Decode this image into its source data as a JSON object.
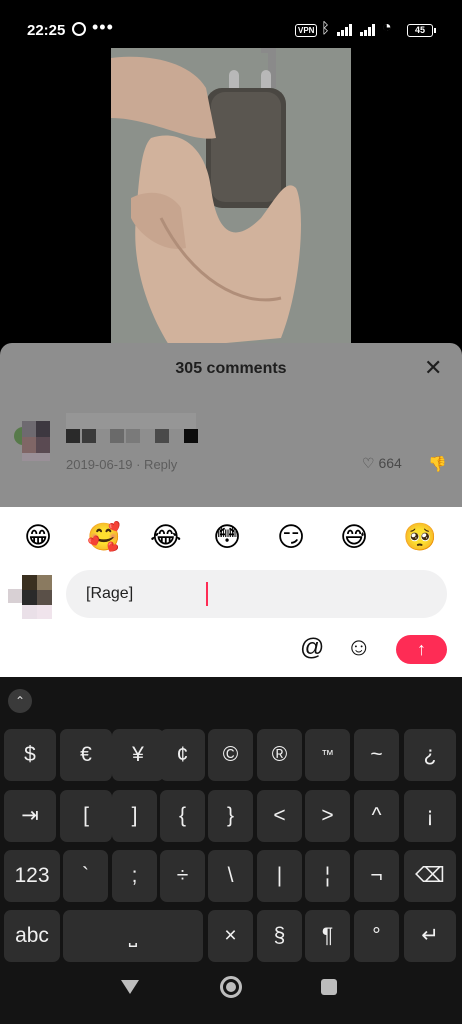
{
  "status_bar": {
    "time": "22:25",
    "dots": "•••",
    "vpn": "VPN",
    "battery": "45"
  },
  "comments": {
    "count_label": "305 comments",
    "comment": {
      "meta": "2019-06-19 · Reply",
      "likes": "664"
    }
  },
  "emoji_row": [
    "😁",
    "🥰",
    "😂",
    "😳",
    "😏",
    "😅",
    "🥺"
  ],
  "composer": {
    "input_value": "[Rage]",
    "at_symbol": "@",
    "smile_symbol": "☺",
    "send_symbol": "↑"
  },
  "keyboard": {
    "toggle": "⌃",
    "row1": [
      "$",
      "€",
      "¥",
      "¢",
      "©",
      "®",
      "™",
      "~",
      "¿"
    ],
    "row2": [
      "⇥",
      "[",
      "]",
      "{",
      "}",
      "<",
      ">",
      "^",
      "¡"
    ],
    "row3": [
      "123",
      "`",
      ";",
      "÷",
      "\\",
      "|",
      "¦",
      "¬",
      "⌫"
    ],
    "row4": [
      "abc",
      "⎵",
      "×",
      "§",
      "¶",
      "°",
      "↵"
    ]
  },
  "colors": {
    "accent": "#fe2c55",
    "keyboard_bg": "#141414",
    "key_bg": "#2e2e2e",
    "sheet_dim": "#8e8e8e"
  }
}
